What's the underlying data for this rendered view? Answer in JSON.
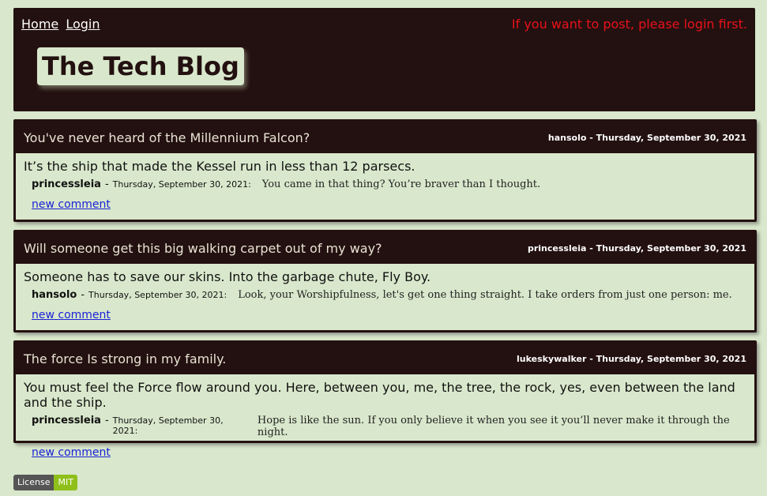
{
  "nav": {
    "home": "Home",
    "login": "Login"
  },
  "login_message": "If you want to post, please login first.",
  "blog_title": "The Tech Blog",
  "posts": [
    {
      "title": "You've never heard of the Millennium Falcon?",
      "meta": "hansolo - Thursday, September 30, 2021",
      "content": "It’s the ship that made the Kessel run in less than 12 parsecs.",
      "comment": {
        "user": "princessleia",
        "dash": "-",
        "date": "Thursday, September 30, 2021:",
        "text": "You came in that thing? You’re braver than I thought."
      },
      "new_comment": "new comment"
    },
    {
      "title": "Will someone get this big walking carpet out of my way?",
      "meta": "princessleia - Thursday, September 30, 2021",
      "content": "Someone has to save our skins. Into the garbage chute, Fly Boy.",
      "comment": {
        "user": "hansolo",
        "dash": "-",
        "date": "Thursday, September 30, 2021:",
        "text": "Look, your Worshipfulness, let's get one thing straight. I take orders from just one person: me."
      },
      "new_comment": "new comment"
    },
    {
      "title": "The force Is strong in my family.",
      "meta": "lukeskywalker - Thursday, September 30, 2021",
      "content": "You must feel the Force flow around you. Here, between you, me, the tree, the rock, yes, even between the land and the ship.",
      "comment": {
        "user": "princessleia",
        "dash": "-",
        "date": "Thursday, September 30, 2021:",
        "text": "Hope is like the sun. If you only believe it when you see it you’ll never make it through the night."
      },
      "new_comment": "new comment"
    }
  ],
  "badge": {
    "label": "License",
    "value": "MIT"
  },
  "colors": {
    "dark": "#231010",
    "background": "#d9e8cc",
    "alert": "#e8111a",
    "link": "#1a22d6",
    "badge_value": "#8fbf1a"
  }
}
